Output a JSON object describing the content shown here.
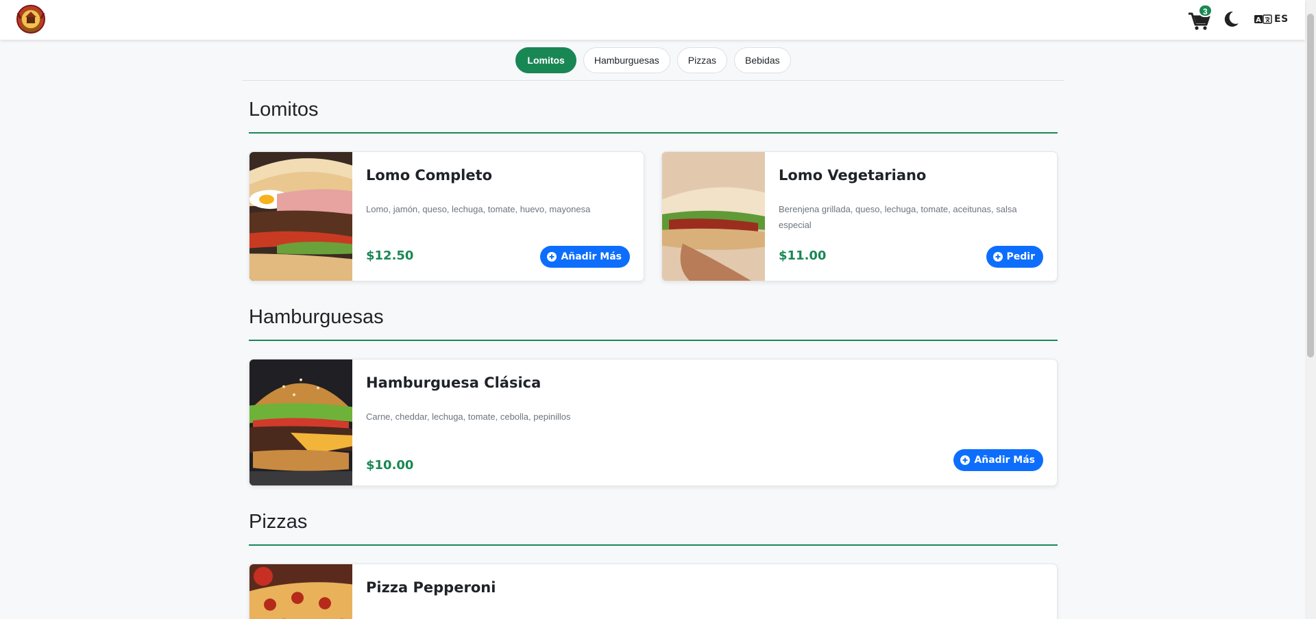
{
  "header": {
    "logo_icon": "restaurant-crest-logo",
    "cart_icon": "shopping-cart-icon",
    "cart_count": "3",
    "theme_icon": "moon-icon",
    "language_icon": "translate-icon",
    "language_label": "ES"
  },
  "tabs": [
    {
      "label": "Lomitos",
      "active": true
    },
    {
      "label": "Hamburguesas",
      "active": false
    },
    {
      "label": "Pizzas",
      "active": false
    },
    {
      "label": "Bebidas",
      "active": false
    }
  ],
  "sections": [
    {
      "title": "Lomitos",
      "items": [
        {
          "name": "Lomo Completo",
          "description": "Lomo, jamón, queso, lechuga, tomate, huevo, mayonesa",
          "price": "$12.50",
          "button": "Añadir Más",
          "image": "steak-sandwich-photo"
        },
        {
          "name": "Lomo Vegetariano",
          "description": "Berenjena grillada, queso, lechuga, tomate, aceitunas, salsa especial",
          "price": "$11.00",
          "button": "Pedir",
          "image": "vegetarian-sandwich-photo"
        }
      ]
    },
    {
      "title": "Hamburguesas",
      "items": [
        {
          "name": "Hamburguesa Clásica",
          "description": "Carne, cheddar, lechuga, tomate, cebolla, pepinillos",
          "price": "$10.00",
          "button": "Añadir Más",
          "image": "burger-photo"
        }
      ]
    },
    {
      "title": "Pizzas",
      "items": [
        {
          "name": "Pizza Pepperoni",
          "image": "pepperoni-pizza-photo"
        }
      ]
    }
  ],
  "colors": {
    "accent_green": "#198754",
    "button_blue": "#0d6efd",
    "page_bg": "#f7f8fa"
  }
}
